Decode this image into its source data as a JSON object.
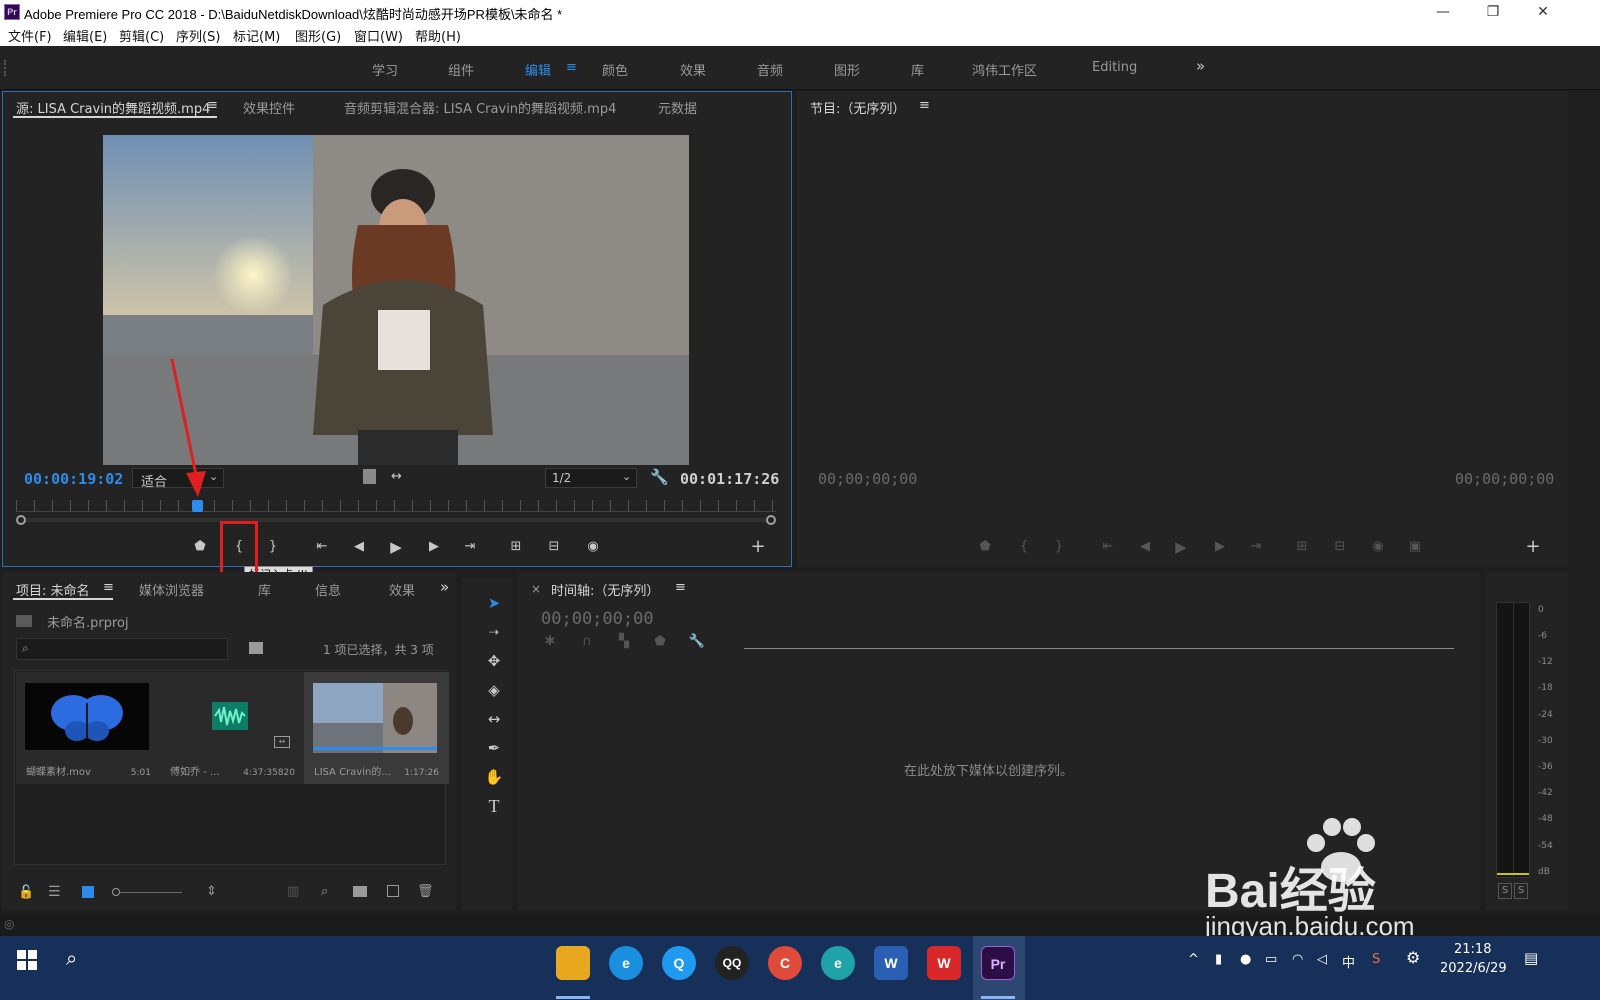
{
  "window": {
    "app_icon": "Pr",
    "title": "Adobe Premiere Pro CC 2018 - D:\\BaiduNetdiskDownload\\炫酷时尚动感开场PR模板\\未命名 *",
    "controls": [
      "—",
      "❐",
      "✕"
    ]
  },
  "menu": [
    "文件(F)",
    "编辑(E)",
    "剪辑(C)",
    "序列(S)",
    "标记(M)",
    "图形(G)",
    "窗口(W)",
    "帮助(H)"
  ],
  "workspaces": [
    "学习",
    "组件",
    "编辑",
    "颜色",
    "效果",
    "音频",
    "图形",
    "库",
    "鸿伟工作区",
    "Editing"
  ],
  "workspace_active": "编辑",
  "source_panel": {
    "tabs": [
      "源: LISA Cravin的舞蹈视频.mp4",
      "效果控件",
      "音频剪辑混合器: LISA Cravin的舞蹈视频.mp4",
      "元数据"
    ],
    "current_time": "00:00:19:02",
    "fit": "适合",
    "resolution": "1/2",
    "duration": "00:01:17:26",
    "playhead_position": 0.235,
    "tooltip": "标记入点 (I)"
  },
  "program_panel": {
    "title": "节目:（无序列）",
    "time_left": "00;00;00;00",
    "time_right": "00;00;00;00"
  },
  "project_panel": {
    "tabs": [
      "项目: 未命名",
      "媒体浏览器",
      "库",
      "信息",
      "效果"
    ],
    "project_file": "未命名.prproj",
    "selection": "1 项已选择，共 3 项",
    "items": [
      {
        "name": "蝴蝶素材.mov",
        "duration": "5:01"
      },
      {
        "name": "傅如乔 - ...",
        "duration": "4:37:35820"
      },
      {
        "name": "LISA Cravin的...",
        "duration": "1:17:26"
      }
    ]
  },
  "timeline_panel": {
    "close": "×",
    "title": "时间轴:（无序列）",
    "timecode": "00;00;00;00",
    "empty_message": "在此处放下媒体以创建序列。"
  },
  "audio_meter": {
    "scale": [
      "0",
      "-6",
      "-12",
      "-18",
      "-24",
      "-30",
      "-36",
      "-42",
      "-48",
      "-54",
      "dB"
    ],
    "solo": [
      "S",
      "S"
    ]
  },
  "taskbar": {
    "apps": [
      "e",
      "Q",
      "QQ",
      "C",
      "e",
      "W",
      "W",
      "Pr"
    ],
    "ime": "中",
    "time": "21:18",
    "date": "2022/6/29"
  },
  "watermark": {
    "logo": "Bai经验",
    "url": "jingyan.baidu.com"
  },
  "colors": {
    "accent": "#2d8ceb",
    "annotation": "#e02020",
    "panel": "#232323",
    "taskbar": "#17305a"
  }
}
